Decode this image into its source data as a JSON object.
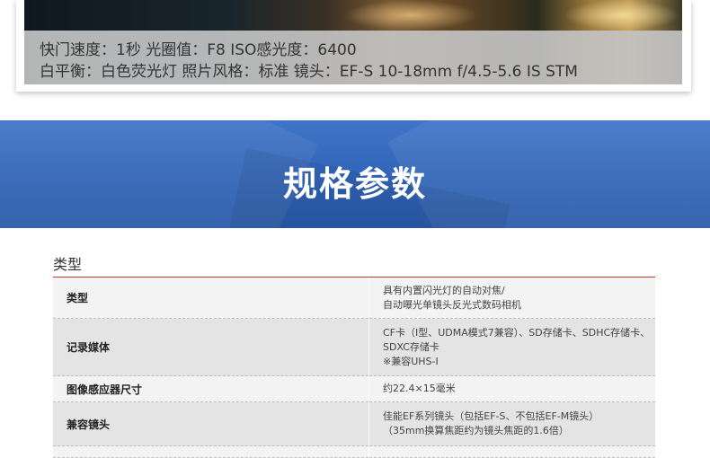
{
  "photo": {
    "caption_line1": "快门速度：1秒    光圈值：F8    ISO感光度：6400",
    "caption_line2": "白平衡：白色荧光灯   照片风格：标准     镜头：EF-S 10-18mm f/4.5-5.6 IS STM"
  },
  "banner": {
    "title": "规格参数"
  },
  "spec_section": {
    "label": "类型",
    "rows": [
      {
        "name": "类型",
        "value_lines": [
          "具有内置闪光灯的自动对焦/",
          "自动曝光单镜头反光式数码相机"
        ]
      },
      {
        "name": "记录媒体",
        "value_lines": [
          "CF卡（I型、UDMA模式7兼容）、SD存储卡、SDHC存储卡、",
          "SDXC存储卡",
          "※兼容UHS-I"
        ]
      },
      {
        "name": "图像感应器尺寸",
        "value_lines": [
          "约22.4×15毫米"
        ]
      },
      {
        "name": "兼容镜头",
        "value_lines": [
          "佳能EF系列镜头（包括EF-S、不包括EF-M镜头）",
          "（35mm换算焦距约为镜头焦距的1.6倍）"
        ]
      }
    ]
  }
}
